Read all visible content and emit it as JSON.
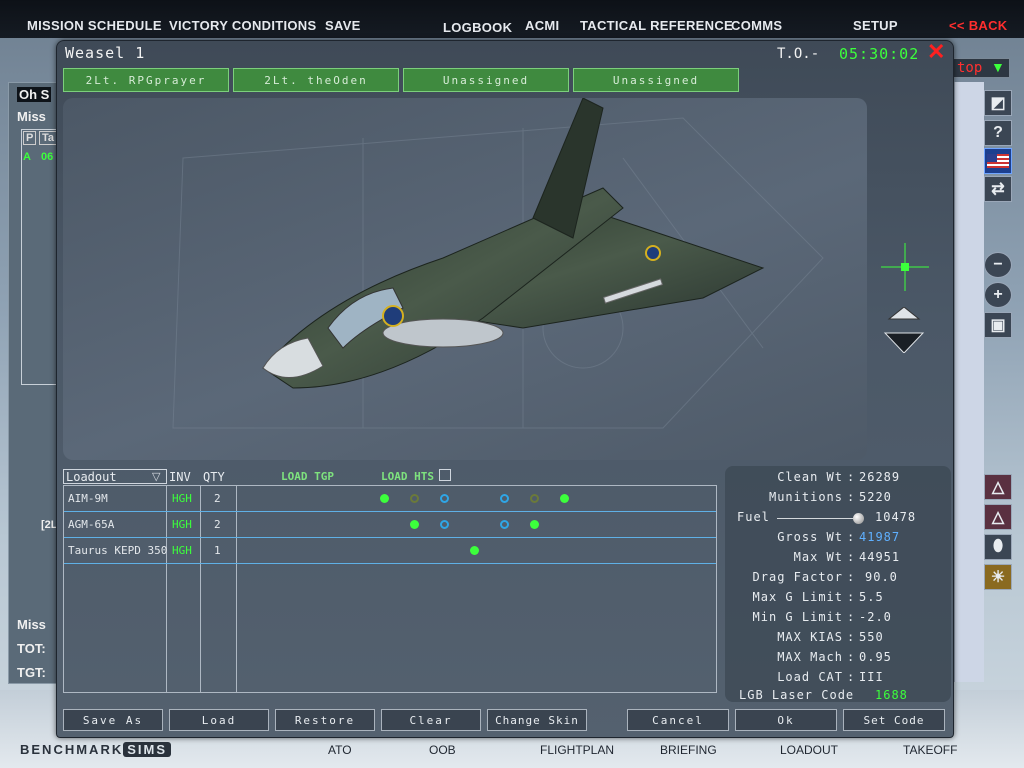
{
  "top_menu": {
    "mission_schedule": "MISSION SCHEDULE",
    "victory_conditions": "VICTORY CONDITIONS",
    "save": "SAVE",
    "logbook": "LOGBOOK",
    "acmi": "ACMI",
    "tactical_reference": "TACTICAL REFERENCE",
    "comms": "COMMS",
    "setup": "SETUP",
    "back": "<< BACK"
  },
  "background_left": {
    "header": "Oh S",
    "label": "Miss",
    "col_p": "P",
    "col_t": "Ta",
    "row_a": "A",
    "row_num": "06",
    "pilot": "[2L",
    "mission": "Miss",
    "tot": "TOT:",
    "tgt": "TGT:"
  },
  "background_right": {
    "dropdown": "top"
  },
  "dialog": {
    "title": "Weasel 1",
    "to_label": "T.O.-",
    "to_time": "05:30:02",
    "pilots": [
      "2Lt. RPGprayer",
      "2Lt. theOden",
      "Unassigned",
      "Unassigned"
    ]
  },
  "loadout": {
    "dropdown_label": "Loadout",
    "inv": "INV",
    "qty": "QTY",
    "load_tgp": "LOAD TGP",
    "load_hts": "LOAD HTS",
    "weapons": [
      {
        "name": "AIM-9M",
        "inv": "HGH",
        "qty": "2"
      },
      {
        "name": "AGM-65A",
        "inv": "HGH",
        "qty": "2"
      },
      {
        "name": "Taurus KEPD 350",
        "inv": "HGH",
        "qty": "1"
      }
    ]
  },
  "stats": {
    "clean_wt": {
      "label": "Clean Wt",
      "value": "26289"
    },
    "munitions": {
      "label": "Munitions",
      "value": "5220"
    },
    "fuel": {
      "label": "Fuel",
      "value": "10478"
    },
    "gross_wt": {
      "label": "Gross Wt",
      "value": "41987"
    },
    "max_wt": {
      "label": "Max Wt",
      "value": "44951"
    },
    "drag_factor": {
      "label": "Drag Factor",
      "value": "90.0"
    },
    "max_g": {
      "label": "Max G Limit",
      "value": "5.5"
    },
    "min_g": {
      "label": "Min G Limit",
      "value": "-2.0"
    },
    "max_kias": {
      "label": "MAX KIAS",
      "value": "550"
    },
    "max_mach": {
      "label": "MAX Mach",
      "value": "0.95"
    },
    "load_cat": {
      "label": "Load CAT",
      "value": "III"
    },
    "lgb_code": {
      "label": "LGB Laser Code",
      "value": "1688"
    }
  },
  "buttons": {
    "save_as": "Save As",
    "load": "Load",
    "restore": "Restore",
    "clear": "Clear",
    "change_skin": "Change Skin",
    "cancel": "Cancel",
    "ok": "Ok",
    "set_code": "Set Code"
  },
  "bottom_nav": {
    "logo_left": "BENCHMARK",
    "logo_right": "SIMS",
    "ato": "ATO",
    "oob": "OOB",
    "flightplan": "FLIGHTPLAN",
    "briefing": "BRIEFING",
    "loadout": "LOADOUT",
    "takeoff": "TAKEOFF"
  },
  "colors": {
    "accent_green": "#3cff3c",
    "accent_red": "#ff2020",
    "accent_blue": "#5fb0ff",
    "tab_green": "#3f8a3f"
  }
}
